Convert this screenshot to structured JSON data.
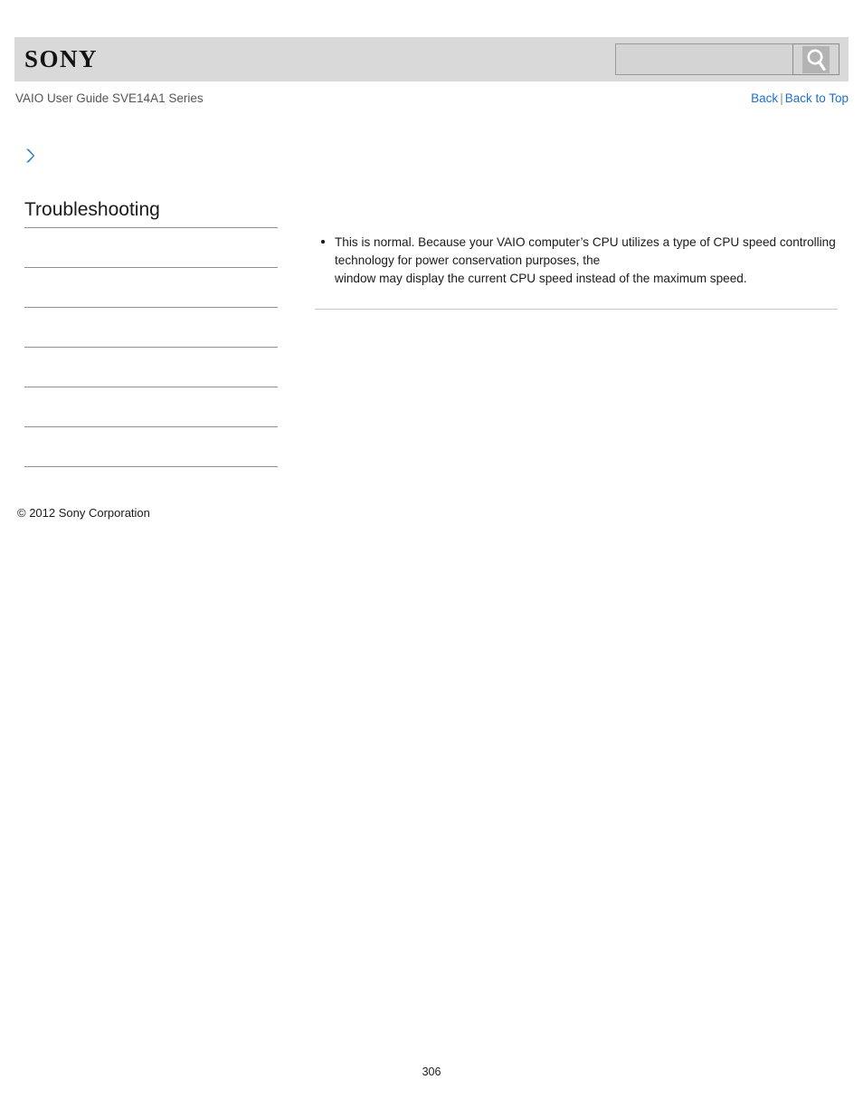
{
  "header": {
    "logo_text": "SONY",
    "search": {
      "value": "",
      "placeholder": "",
      "icon": "search-icon",
      "button_label": ""
    }
  },
  "subheader": {
    "guide_title": "VAIO User Guide SVE14A1 Series",
    "links": {
      "back": "Back",
      "separator": "|",
      "back_to_top": "Back to Top"
    }
  },
  "breadcrumb": {
    "icon": "chevron-right-icon",
    "text": ""
  },
  "sidebar": {
    "title": "Troubleshooting",
    "items": [
      {
        "label": ""
      },
      {
        "label": ""
      },
      {
        "label": ""
      },
      {
        "label": ""
      },
      {
        "label": ""
      },
      {
        "label": ""
      }
    ]
  },
  "main": {
    "bullets": [
      "This is normal. Because your VAIO computer’s CPU utilizes a type of CPU speed controlling technology for power conservation purposes, the\nwindow may display the current CPU speed instead of the maximum speed."
    ]
  },
  "footer": {
    "copyright": "© 2012 Sony Corporation",
    "page_number": "306"
  },
  "colors": {
    "header_band": "#d9d9d9",
    "link_blue": "#1c6fd0",
    "chevron_blue": "#3d87c8",
    "rule_gray": "#8f8f8f",
    "content_rule_gray": "#c8c8c8",
    "text_dark": "#1b1b1b",
    "subtitle_gray": "#555555"
  }
}
